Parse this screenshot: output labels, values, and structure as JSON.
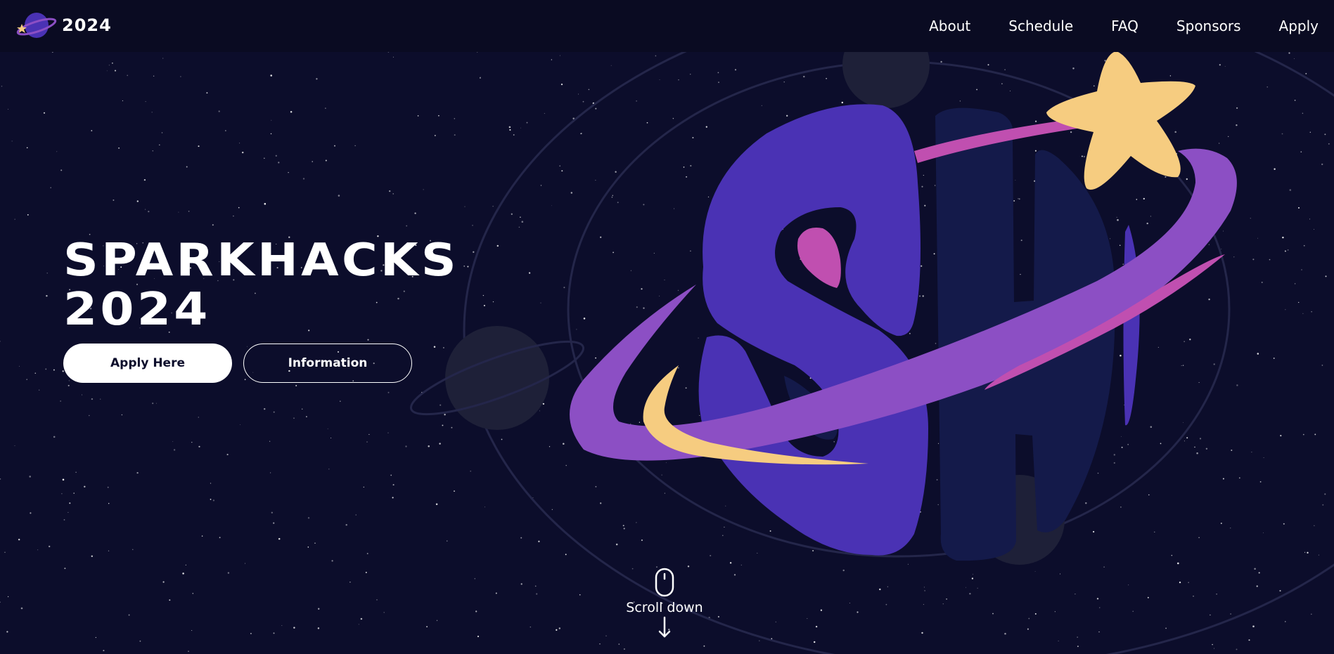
{
  "nav": {
    "brand_text": "2024",
    "links": [
      "About",
      "Schedule",
      "FAQ",
      "Sponsors",
      "Apply"
    ]
  },
  "hero": {
    "title_line1": "SPARKHACKS",
    "title_line2": "2024",
    "primary_button": "Apply Here",
    "secondary_button": "Information",
    "logo_letters": "SH"
  },
  "scroll": {
    "label": "Scroll down"
  },
  "colors": {
    "background": "#0c0d2b",
    "navbar": "#0a0b22",
    "violet": "#4a32b4",
    "navy_letter": "#141a4a",
    "ring_purple": "#8c4fc4",
    "magenta": "#c04fb0",
    "gold": "#f6cc80",
    "planet_gray": "#1e2038"
  },
  "icons": {
    "logo": "sparkhacks-planet-logo",
    "scroll": "mouse-icon",
    "arrow": "arrow-down-icon"
  }
}
